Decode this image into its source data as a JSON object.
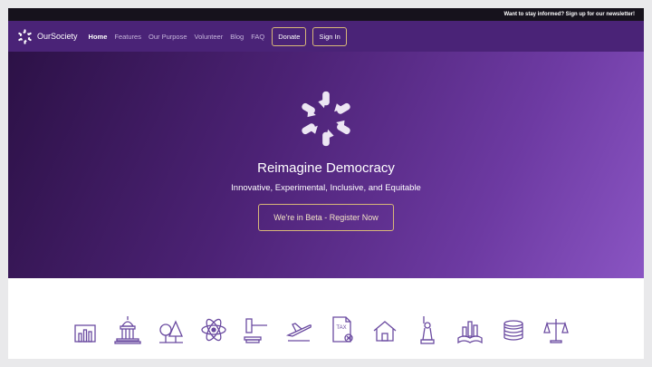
{
  "topbar": {
    "newsletter_text": "Want to stay informed? Sign up for our newsletter!"
  },
  "nav": {
    "brand": "OurSociety",
    "links": [
      "Home",
      "Features",
      "Our Purpose",
      "Volunteer",
      "Blog",
      "FAQ"
    ],
    "active": "Home",
    "donate_label": "Donate",
    "signin_label": "Sign In"
  },
  "hero": {
    "title": "Reimagine Democracy",
    "subtitle": "Innovative, Experimental, Inclusive, and Equitable",
    "cta_label": "We're in Beta - Register Now"
  },
  "feature_icons": {
    "tax_label": "TAX",
    "items": [
      "bar-chart-icon",
      "capitol-building-icon",
      "trees-icon",
      "atom-icon",
      "gavel-icon",
      "airplane-icon",
      "tax-document-icon",
      "house-icon",
      "statue-of-liberty-icon",
      "book-city-icon",
      "coins-icon",
      "scales-icon"
    ]
  },
  "colors": {
    "nav_bg": "#4a2377",
    "topbar_bg": "#16121c",
    "accent_border": "#d8b878",
    "icon_stroke": "#6a4aa0",
    "hero_gradient_start": "#2c1146",
    "hero_gradient_end": "#8a55c3"
  }
}
